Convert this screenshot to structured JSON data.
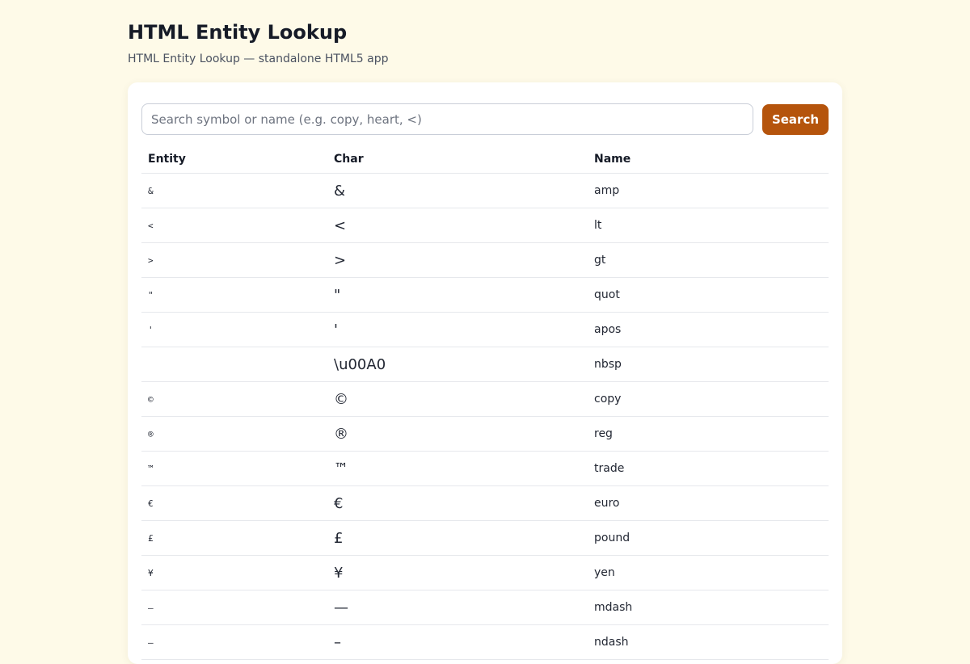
{
  "header": {
    "title": "HTML Entity Lookup",
    "subtitle": "HTML Entity Lookup — standalone HTML5 app"
  },
  "search": {
    "placeholder": "Search symbol or name (e.g. copy, heart, <)",
    "value": "",
    "button_label": "Search"
  },
  "table": {
    "columns": [
      "Entity",
      "Char",
      "Name"
    ],
    "rows": [
      {
        "entity": "&",
        "char": "&",
        "name": "amp"
      },
      {
        "entity": "<",
        "char": "<",
        "name": "lt"
      },
      {
        "entity": ">",
        "char": ">",
        "name": "gt"
      },
      {
        "entity": "\"",
        "char": "\"",
        "name": "quot"
      },
      {
        "entity": "'",
        "char": "'",
        "name": "apos"
      },
      {
        "entity": "",
        "char": "\\u00A0",
        "name": "nbsp"
      },
      {
        "entity": "©",
        "char": "©",
        "name": "copy"
      },
      {
        "entity": "®",
        "char": "®",
        "name": "reg"
      },
      {
        "entity": "™",
        "char": "™",
        "name": "trade"
      },
      {
        "entity": "€",
        "char": "€",
        "name": "euro"
      },
      {
        "entity": "£",
        "char": "£",
        "name": "pound"
      },
      {
        "entity": "¥",
        "char": "¥",
        "name": "yen"
      },
      {
        "entity": "–",
        "char": "—",
        "name": "mdash"
      },
      {
        "entity": "–",
        "char": "–",
        "name": "ndash"
      }
    ]
  },
  "colors": {
    "background": "#fefae8",
    "card": "#ffffff",
    "accent": "#b5540c",
    "text": "#1a1f2b",
    "muted": "#4a5160",
    "border": "#e6e8ec"
  }
}
